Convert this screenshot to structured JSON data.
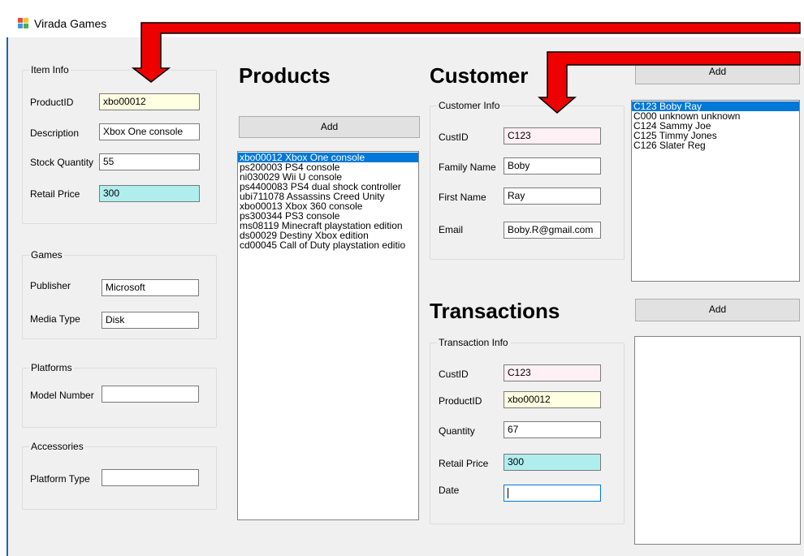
{
  "window": {
    "title": "Virada Games"
  },
  "item_info": {
    "legend": "Item Info",
    "product_id": {
      "label": "ProductID",
      "value": "xbo00012"
    },
    "description": {
      "label": "Description",
      "value": "Xbox One console"
    },
    "stock_quantity": {
      "label": "Stock Quantity",
      "value": "55"
    },
    "retail_price": {
      "label": "Retail Price",
      "value": "300"
    }
  },
  "games": {
    "legend": "Games",
    "publisher": {
      "label": "Publisher",
      "value": "Microsoft"
    },
    "media_type": {
      "label": "Media Type",
      "value": "Disk"
    }
  },
  "platforms": {
    "legend": "Platforms",
    "model_number": {
      "label": "Model Number",
      "value": ""
    }
  },
  "accessories": {
    "legend": "Accessories",
    "platform_type": {
      "label": "Platform Type",
      "value": ""
    }
  },
  "products": {
    "heading": "Products",
    "add_label": "Add",
    "items": [
      "xbo00012 Xbox One console",
      "ps200003 PS4 console",
      "ni030029 Wii U console",
      "ps4400083 PS4 dual shock controller",
      "ubi711078 Assassins Creed Unity",
      "xbo00013 Xbox 360 console",
      "ps300344 PS3 console",
      "ms08119 Minecraft playstation edition",
      "ds00029 Destiny Xbox edition",
      "cd00045 Call of Duty playstation editio"
    ],
    "selected_index": 0
  },
  "customer": {
    "heading": "Customer",
    "add_label": "Add",
    "legend": "Customer Info",
    "cust_id": {
      "label": "CustID",
      "value": "C123"
    },
    "family_name": {
      "label": "Family Name",
      "value": "Boby"
    },
    "first_name": {
      "label": "First Name",
      "value": "Ray"
    },
    "email": {
      "label": "Email",
      "value": "Boby.R@gmail.com"
    },
    "list": [
      "C123 Boby  Ray",
      "C000 unknown unknown",
      "C124 Sammy Joe",
      "C125 Timmy Jones",
      "C126 Slater Reg"
    ],
    "selected_index": 0
  },
  "transactions": {
    "heading": "Transactions",
    "add_label": "Add",
    "legend": "Transaction Info",
    "cust_id": {
      "label": "CustID",
      "value": "C123"
    },
    "product_id": {
      "label": "ProductID",
      "value": "xbo00012"
    },
    "quantity": {
      "label": "Quantity",
      "value": "67"
    },
    "retail_price": {
      "label": "Retail Price",
      "value": "300"
    },
    "date": {
      "label": "Date",
      "value": ""
    }
  },
  "colors": {
    "arrow_fill": "#ee0000",
    "selection": "#0078d7",
    "yellow_field": "#ffffe1",
    "pink_field": "#fff0f5",
    "cyan_field": "#b0eeee"
  }
}
